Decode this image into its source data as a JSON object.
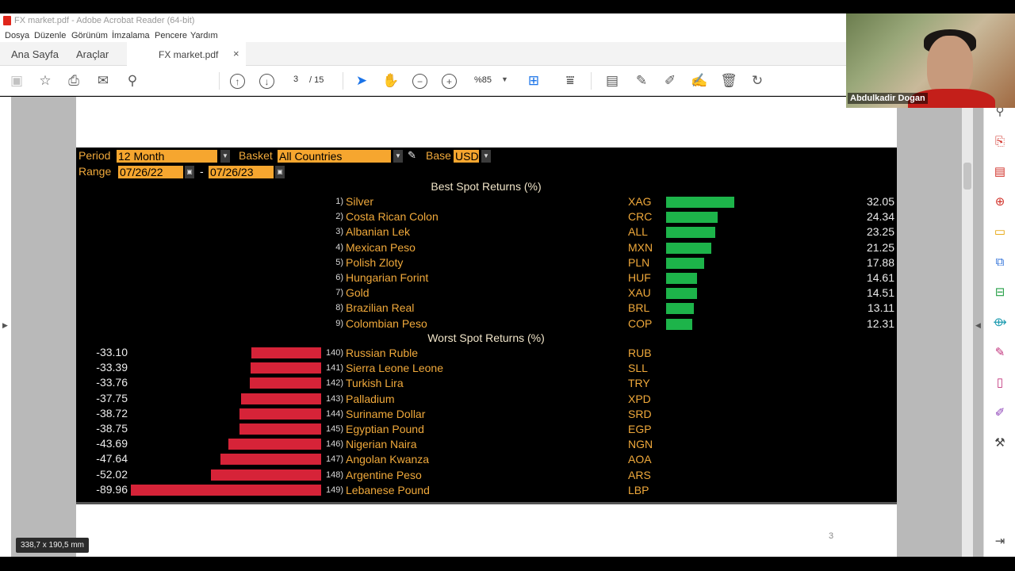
{
  "window": {
    "title": "FX market.pdf - Adobe Acrobat Reader (64-bit)"
  },
  "menu": [
    "Dosya",
    "Düzenle",
    "Görünüm",
    "İmzalama",
    "Pencere",
    "Yardım"
  ],
  "tabs": {
    "home": "Ana Sayfa",
    "tools": "Araçlar",
    "document": "FX market.pdf",
    "close": "×"
  },
  "toolbar": {
    "page": "3",
    "total": "/ 15",
    "zoom": "%85"
  },
  "panel": {
    "period_label": "Period",
    "period_value": "12 Month",
    "basket_label": "Basket",
    "basket_value": "All Countries",
    "base_label": "Base",
    "base_value": "USD",
    "range_label": "Range",
    "range_from": "07/26/22",
    "range_dash": "-",
    "range_to": "07/26/23",
    "best_title": "Best Spot Returns (%)",
    "worst_title": "Worst Spot Returns (%)"
  },
  "best": [
    {
      "rank": "1)",
      "name": "Silver",
      "code": "XAG",
      "value": "32.05",
      "v": 32.05
    },
    {
      "rank": "2)",
      "name": "Costa Rican Colon",
      "code": "CRC",
      "value": "24.34",
      "v": 24.34
    },
    {
      "rank": "3)",
      "name": "Albanian Lek",
      "code": "ALL",
      "value": "23.25",
      "v": 23.25
    },
    {
      "rank": "4)",
      "name": "Mexican Peso",
      "code": "MXN",
      "value": "21.25",
      "v": 21.25
    },
    {
      "rank": "5)",
      "name": "Polish Zloty",
      "code": "PLN",
      "value": "17.88",
      "v": 17.88
    },
    {
      "rank": "6)",
      "name": "Hungarian Forint",
      "code": "HUF",
      "value": "14.61",
      "v": 14.61
    },
    {
      "rank": "7)",
      "name": "Gold",
      "code": "XAU",
      "value": "14.51",
      "v": 14.51
    },
    {
      "rank": "8)",
      "name": "Brazilian Real",
      "code": "BRL",
      "value": "13.11",
      "v": 13.11
    },
    {
      "rank": "9)",
      "name": "Colombian Peso",
      "code": "COP",
      "value": "12.31",
      "v": 12.31
    }
  ],
  "worst": [
    {
      "rank": "140)",
      "name": "Russian Ruble",
      "code": "RUB",
      "value": "-33.10",
      "v": 33.1
    },
    {
      "rank": "141)",
      "name": "Sierra Leone Leone",
      "code": "SLL",
      "value": "-33.39",
      "v": 33.39
    },
    {
      "rank": "142)",
      "name": "Turkish Lira",
      "code": "TRY",
      "value": "-33.76",
      "v": 33.76
    },
    {
      "rank": "143)",
      "name": "Palladium",
      "code": "XPD",
      "value": "-37.75",
      "v": 37.75
    },
    {
      "rank": "144)",
      "name": "Suriname Dollar",
      "code": "SRD",
      "value": "-38.72",
      "v": 38.72
    },
    {
      "rank": "145)",
      "name": "Egyptian Pound",
      "code": "EGP",
      "value": "-38.75",
      "v": 38.75
    },
    {
      "rank": "146)",
      "name": "Nigerian Naira",
      "code": "NGN",
      "value": "-43.69",
      "v": 43.69
    },
    {
      "rank": "147)",
      "name": "Angolan Kwanza",
      "code": "AOA",
      "value": "-47.64",
      "v": 47.64
    },
    {
      "rank": "148)",
      "name": "Argentine Peso",
      "code": "ARS",
      "value": "-52.02",
      "v": 52.02
    },
    {
      "rank": "149)",
      "name": "Lebanese Pound",
      "code": "LBP",
      "value": "-89.96",
      "v": 89.96
    }
  ],
  "page_footer": "3",
  "dimensions": "338,7 x 190,5 mm",
  "webcam": {
    "name": "Abdulkadir Dogan"
  },
  "colors": {
    "orange": "#f6a62f",
    "green": "#1db44a",
    "red": "#d62338"
  }
}
